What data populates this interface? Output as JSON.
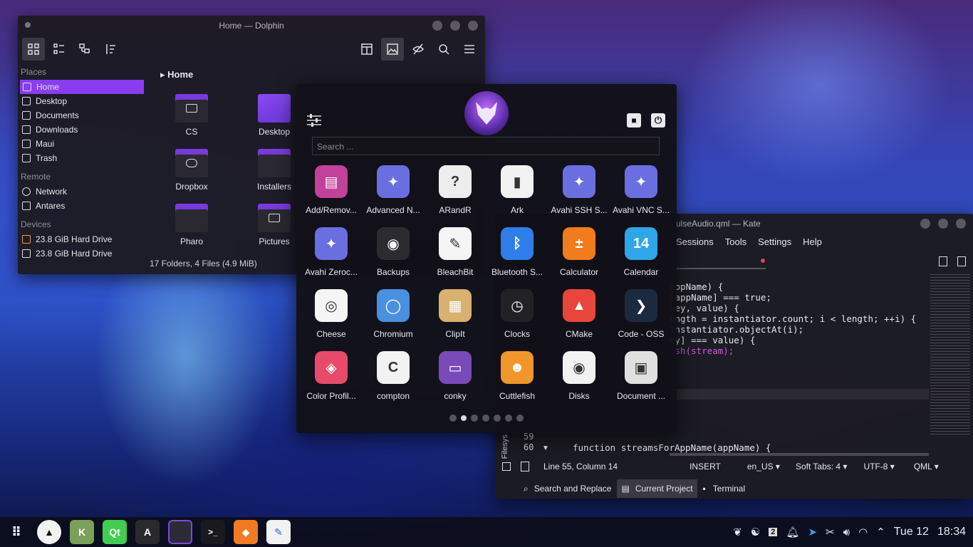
{
  "dolphin": {
    "title": "Home — Dolphin",
    "breadcrumb": "Home",
    "places_label": "Places",
    "places": [
      "Home",
      "Desktop",
      "Documents",
      "Downloads",
      "Maui",
      "Trash"
    ],
    "remote_label": "Remote",
    "remote": [
      "Network",
      "Antares"
    ],
    "devices_label": "Devices",
    "devices": [
      "23.8 GiB Hard Drive",
      "23.8 GiB Hard Drive"
    ],
    "folders": [
      "CS",
      "Desktop",
      "Dropbox",
      "Installers",
      "Pharo",
      "Pictures"
    ],
    "status": "17 Folders, 4 Files (4.9 MiB)"
  },
  "launcher": {
    "search_placeholder": "Search ...",
    "apps": [
      {
        "label": "Add/Remov...",
        "color": "#c2419a",
        "glyph": "▤"
      },
      {
        "label": "Advanced N...",
        "color": "#6b6ee0",
        "glyph": "✦"
      },
      {
        "label": "ARandR",
        "color": "#ededed",
        "glyph": "?"
      },
      {
        "label": "Ark",
        "color": "#f2f2f2",
        "glyph": "▮"
      },
      {
        "label": "Avahi SSH S...",
        "color": "#6b6ee0",
        "glyph": "✦"
      },
      {
        "label": "Avahi VNC S...",
        "color": "#6b6ee0",
        "glyph": "✦"
      },
      {
        "label": "Avahi Zeroc...",
        "color": "#6b6ee0",
        "glyph": "✦"
      },
      {
        "label": "Backups",
        "color": "#2c2c30",
        "glyph": "◉"
      },
      {
        "label": "BleachBit",
        "color": "#f5f5f5",
        "glyph": "✎"
      },
      {
        "label": "Bluetooth S...",
        "color": "#2f7de8",
        "glyph": "ᛒ"
      },
      {
        "label": "Calculator",
        "color": "#f27b1c",
        "glyph": "±"
      },
      {
        "label": "Calendar",
        "color": "#2fa6e8",
        "glyph": "14"
      },
      {
        "label": "Cheese",
        "color": "#f5f5f5",
        "glyph": "◎"
      },
      {
        "label": "Chromium",
        "color": "#4a8fe0",
        "glyph": "◯"
      },
      {
        "label": "ClipIt",
        "color": "#d8b070",
        "glyph": "▦"
      },
      {
        "label": "Clocks",
        "color": "#222226",
        "glyph": "◷"
      },
      {
        "label": "CMake",
        "color": "#e8453c",
        "glyph": "▲"
      },
      {
        "label": "Code - OSS",
        "color": "#1c2a40",
        "glyph": "❯"
      },
      {
        "label": "Color Profil...",
        "color": "#e84b6a",
        "glyph": "◈"
      },
      {
        "label": "compton",
        "color": "#f2f2f2",
        "glyph": "C"
      },
      {
        "label": "conky",
        "color": "#7a4ab8",
        "glyph": "▭"
      },
      {
        "label": "Cuttlefish",
        "color": "#f0962a",
        "glyph": "☻"
      },
      {
        "label": "Disks",
        "color": "#f2f2f2",
        "glyph": "◉"
      },
      {
        "label": "Document ...",
        "color": "#e0e0e0",
        "glyph": "▣"
      }
    ]
  },
  "kate": {
    "title": "ulseAudio.qml — Kate",
    "menu": [
      "Sessions",
      "Tools",
      "Settings",
      "Help"
    ],
    "code_lines": [
      "appName) {",
      "[appName] === true;",
      "",
      "",
      "key, value) {",
      "",
      "ength = instantiator.count; i < length; ++i) {",
      "instantiator.objectAt(i);",
      "ey] === value) {",
      "ush(stream);"
    ],
    "line59": "59",
    "line60": "60",
    "line60_code": "function streamsForAppName(appName) {",
    "sidebar_tab": "Filesys",
    "status": {
      "position": "Line 55, Column 14",
      "mode": "INSERT",
      "language": "en_US",
      "tabs": "Soft Tabs: 4",
      "encoding": "UTF-8",
      "syntax": "QML"
    },
    "bottom_tabs": [
      "Search and Replace",
      "Current Project",
      "Terminal"
    ]
  },
  "taskbar": {
    "clock_day": "Tue 12",
    "clock_time": "18:34"
  }
}
